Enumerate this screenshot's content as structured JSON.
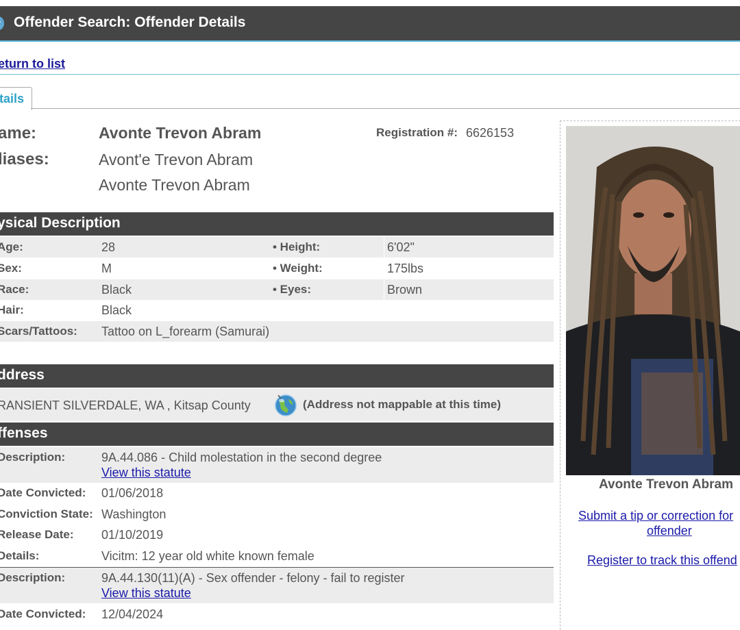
{
  "header": {
    "title": "Offender Search: Offender Details",
    "icon": "globe-icon"
  },
  "nav": {
    "return_link": "eturn to list",
    "tab": "tails"
  },
  "identity": {
    "name_label": "ame:",
    "name": "Avonte Trevon Abram",
    "aliases_label": "liases:",
    "aliases": [
      "Avont'e Trevon Abram",
      "Avonte Trevon Abram"
    ],
    "registration_label": "Registration #:",
    "registration_number": "6626153"
  },
  "physical": {
    "title": "ysical Description",
    "rows": [
      {
        "label": "Age:",
        "value": "28",
        "label2": "• Height:",
        "value2": "6'02\""
      },
      {
        "label": "Sex:",
        "value": "M",
        "label2": "• Weight:",
        "value2": "175lbs"
      },
      {
        "label": "Race:",
        "value": "Black",
        "label2": "• Eyes:",
        "value2": "Brown"
      },
      {
        "label": "Hair:",
        "value": "Black"
      },
      {
        "label": "Scars/Tattoos:",
        "value": "Tattoo on L_forearm (Samurai)"
      }
    ]
  },
  "address": {
    "title": "ddress",
    "text": "RANSIENT SILVERDALE, WA , Kitsap County",
    "map_note": "(Address not mappable at this time)"
  },
  "offenses": {
    "title": "ffenses",
    "description_label": "Description:",
    "date_convicted_label": "Date Convicted:",
    "conviction_state_label": "Conviction State:",
    "release_date_label": "Release Date:",
    "details_label": "Details:",
    "statute_link": "View this statute",
    "items": [
      {
        "description": "9A.44.086 - Child molestation in the second degree",
        "date_convicted": "01/06/2018",
        "conviction_state": "Washington",
        "release_date": "01/10/2019",
        "details": "Vicitm: 12 year old white known female"
      },
      {
        "description": "9A.44.130(11)(A) - Sex offender - felony - fail to register",
        "date_convicted": "12/04/2024"
      }
    ]
  },
  "sidebar": {
    "photo_caption": "Avonte Trevon Abram",
    "tip_link_line1": "Submit a tip or correction for",
    "tip_link_line2": "offender",
    "track_link": "Register to track this offend"
  },
  "colors": {
    "header_bg": "#454545",
    "accent": "#59b7d8",
    "link": "#1a1aaa",
    "row_shade": "#ececec"
  }
}
